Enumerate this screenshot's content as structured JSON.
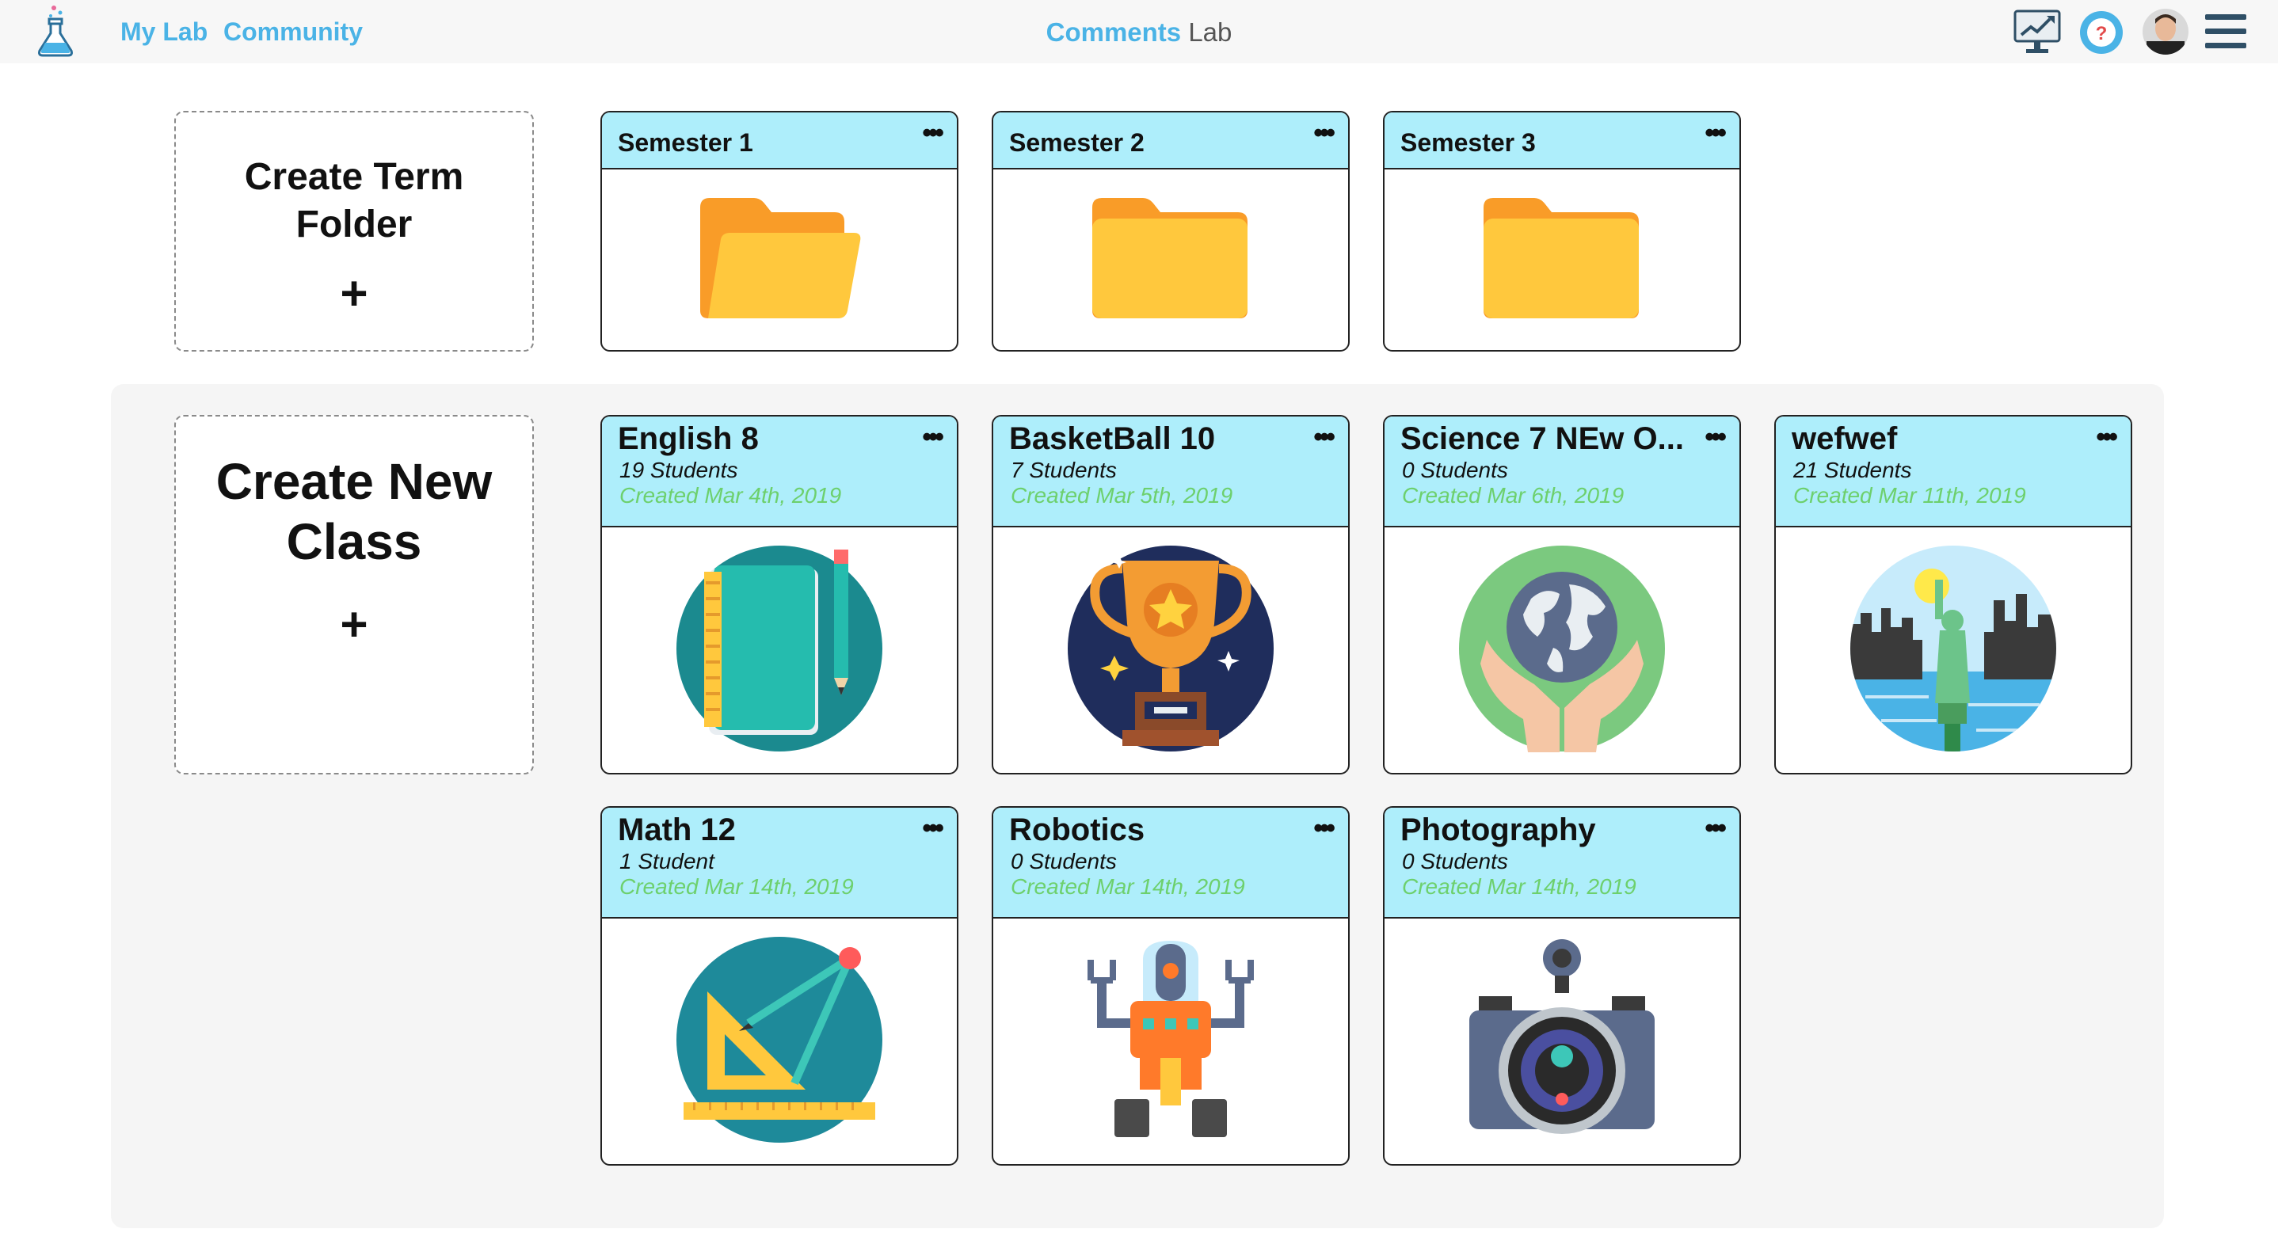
{
  "header": {
    "nav": [
      "My Lab",
      "Community"
    ],
    "center_title_accent": "Comments",
    "center_title_rest": "Lab",
    "icons": [
      "flask-logo-icon",
      "analytics-icon",
      "help-icon",
      "avatar",
      "menu-icon"
    ]
  },
  "create_term": {
    "title": "Create Term Folder",
    "plus": "+"
  },
  "create_class": {
    "title": "Create New Class",
    "plus": "+"
  },
  "folders": [
    {
      "title": "Semester 1",
      "menu": "•••"
    },
    {
      "title": "Semester 2",
      "menu": "•••"
    },
    {
      "title": "Semester 3",
      "menu": "•••"
    }
  ],
  "classes": [
    {
      "title": "English 8",
      "students": "19 Students",
      "created": "Created Mar 4th, 2019",
      "menu": "•••",
      "icon": "notebook-icon"
    },
    {
      "title": "BasketBall 10",
      "students": "7 Students",
      "created": "Created Mar 5th, 2019",
      "menu": "•••",
      "icon": "trophy-icon"
    },
    {
      "title": "Science 7 NEw O...",
      "students": "0 Students",
      "created": "Created Mar 6th, 2019",
      "menu": "•••",
      "icon": "globe-hands-icon"
    },
    {
      "title": "wefwef",
      "students": "21 Students",
      "created": "Created Mar 11th, 2019",
      "menu": "•••",
      "icon": "statue-of-liberty-icon"
    },
    {
      "title": "Math 12",
      "students": "1 Student",
      "created": "Created Mar 14th, 2019",
      "menu": "•••",
      "icon": "geometry-tools-icon"
    },
    {
      "title": "Robotics",
      "students": "0 Students",
      "created": "Created Mar 14th, 2019",
      "menu": "•••",
      "icon": "robot-icon"
    },
    {
      "title": "Photography",
      "students": "0 Students",
      "created": "Created Mar 14th, 2019",
      "menu": "•••",
      "icon": "camera-icon"
    }
  ],
  "colors": {
    "accent": "#4ab3e6",
    "card_header": "#aeeefb",
    "date_green": "#6dd06d",
    "folder_yellow": "#ffc83d"
  }
}
